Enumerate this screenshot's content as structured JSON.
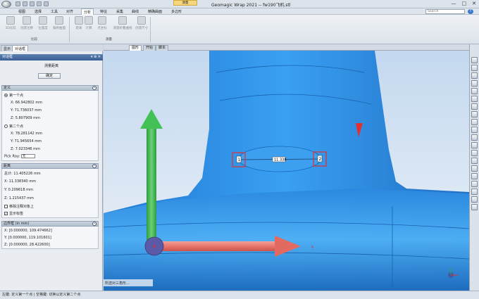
{
  "titlebar": {
    "context_tab": "测量",
    "title": "Geomagic Wrap 2021 -- fw190飞机.stl",
    "minimize": "—",
    "maximize": "□",
    "close": "✕"
  },
  "menu": {
    "items": [
      "视图",
      "选择",
      "工具",
      "对齐",
      "分析",
      "特征",
      "采集",
      "曲线",
      "精确曲面",
      "多边形"
    ],
    "active_index": 4,
    "search_placeholder": "Search",
    "help": "?"
  },
  "ribbon": {
    "buttons": [
      {
        "label": "3D比较",
        "icon": "compare-3d-icon"
      },
      {
        "label": "创建注释",
        "icon": "annotation-icon"
      },
      {
        "label": "位置度",
        "icon": "position-icon"
      },
      {
        "label": "偏移曲面",
        "icon": "offset-surface-icon"
      },
      {
        "label": "距离",
        "icon": "distance-icon"
      },
      {
        "label": "计算",
        "icon": "calculate-icon"
      },
      {
        "label": "点坐标",
        "icon": "point-coordinate-icon"
      },
      {
        "label": "测量折叠曲线",
        "icon": "fold-curve-icon"
      },
      {
        "label": "创建尺寸",
        "icon": "create-dimension-icon"
      }
    ],
    "group_labels": [
      "比较",
      "测量"
    ]
  },
  "left_panel": {
    "tabs": [
      "显示",
      "对话框"
    ],
    "active_tab": 1,
    "dialog_title": "对话框",
    "dialog_subtitle": "测量距离",
    "ok_button": "确定",
    "definition": {
      "header": "定义",
      "first_point": "第一个点",
      "p1": {
        "x": "X: 66.942802 mm",
        "y": "Y: 71.736037 mm",
        "z": "Z: 5.807909 mm"
      },
      "second_point": "第二个点",
      "p2": {
        "x": "X: 78.281142 mm",
        "y": "Y: 71.945654 mm",
        "z": "Z: 7.023346 mm"
      },
      "pick_ray_label": "Pick Ray:",
      "pick_ray_value": "无"
    },
    "distance": {
      "header": "距离",
      "total": "总计: 11.405226 mm",
      "x": "X: 11.338340 mm",
      "y": "Y: 0.209618 mm",
      "z": "Z: 1.215437 mm",
      "option1": "移除注释对象上",
      "option2": "显示标签",
      "option1_checked": false,
      "option2_checked": true
    },
    "bbox": {
      "header": "边界框 (in mm)",
      "x": "X: [0.000000, 109.474662]",
      "y": "Y: [0.000000, 119.101601]",
      "z": "Z: [0.000000, 28.422600]"
    }
  },
  "viewport": {
    "tabs": [
      "图形",
      "开始",
      "脚本"
    ],
    "active_tab": 0,
    "measure_label": "11.338",
    "point1_label": "1",
    "point2_label": "2",
    "hint_text": "所选对三角形..."
  },
  "right_toolbar": {
    "icons": [
      "view-home-icon",
      "fit-view-icon",
      "rotate-icon",
      "pan-icon",
      "zoom-icon",
      "zoom-window-icon",
      "view-front-icon",
      "view-back-icon",
      "view-left-icon",
      "view-right-icon",
      "view-top-icon",
      "view-bottom-icon",
      "view-iso-icon",
      "shading-icon",
      "wireframe-icon",
      "lighting-icon",
      "color-icon",
      "section-icon",
      "measure-icon",
      "screenshot-icon"
    ]
  },
  "statusbar": {
    "text": "左键: 定义第一个点 | 空格键: 切换以定义第二个点"
  },
  "colors": {
    "model": "#2f8ee6",
    "background_top": "#cfe1f3",
    "background_bottom": "#eef3f8",
    "accent_red": "#e23030",
    "axis_x": "#e8756b",
    "axis_y": "#3fb14f",
    "axis_origin": "#5a5aa8"
  }
}
